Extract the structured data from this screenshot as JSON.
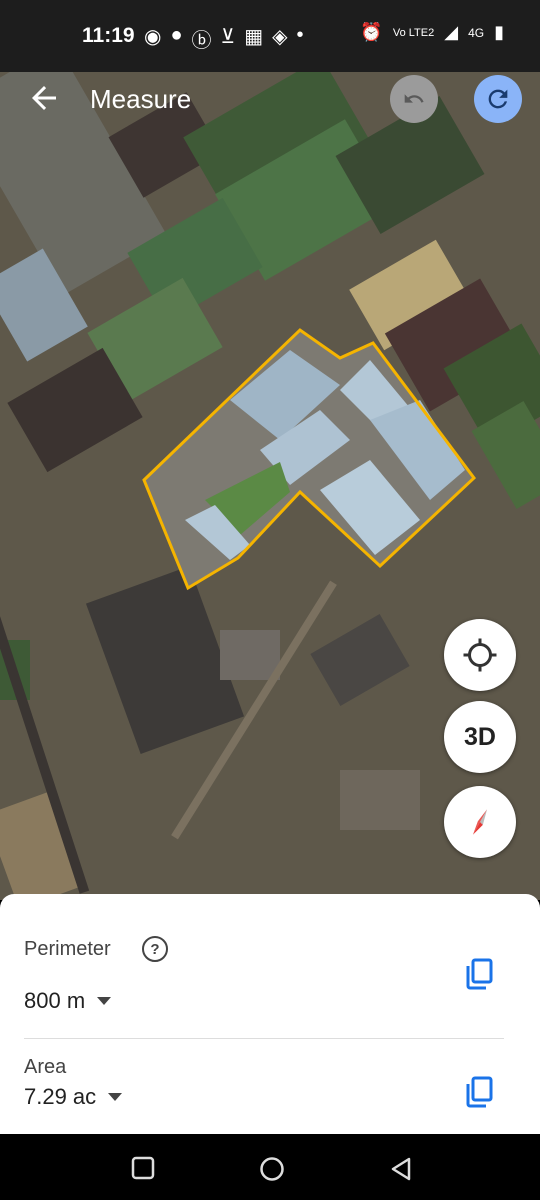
{
  "status_bar": {
    "time": "11:19",
    "network_badge": "4G",
    "volte_badge": "Vo LTE2"
  },
  "top_bar": {
    "title": "Measure",
    "back_icon": "arrow-left-icon",
    "undo_icon": "undo-icon",
    "redo_icon": "redo-icon"
  },
  "map": {
    "overlay_color": "#f5b400"
  },
  "controls": {
    "three_d_label": "3D",
    "location_icon": "my-location-icon",
    "compass_icon": "compass-icon"
  },
  "measure_sheet": {
    "perimeter_label": "Perimeter",
    "perimeter_value": "800 m",
    "area_label": "Area",
    "area_value": "7.29 ac"
  },
  "nav_bar": {
    "recents_icon": "recents-square-icon",
    "home_icon": "home-circle-icon",
    "back_icon": "back-triangle-icon"
  }
}
